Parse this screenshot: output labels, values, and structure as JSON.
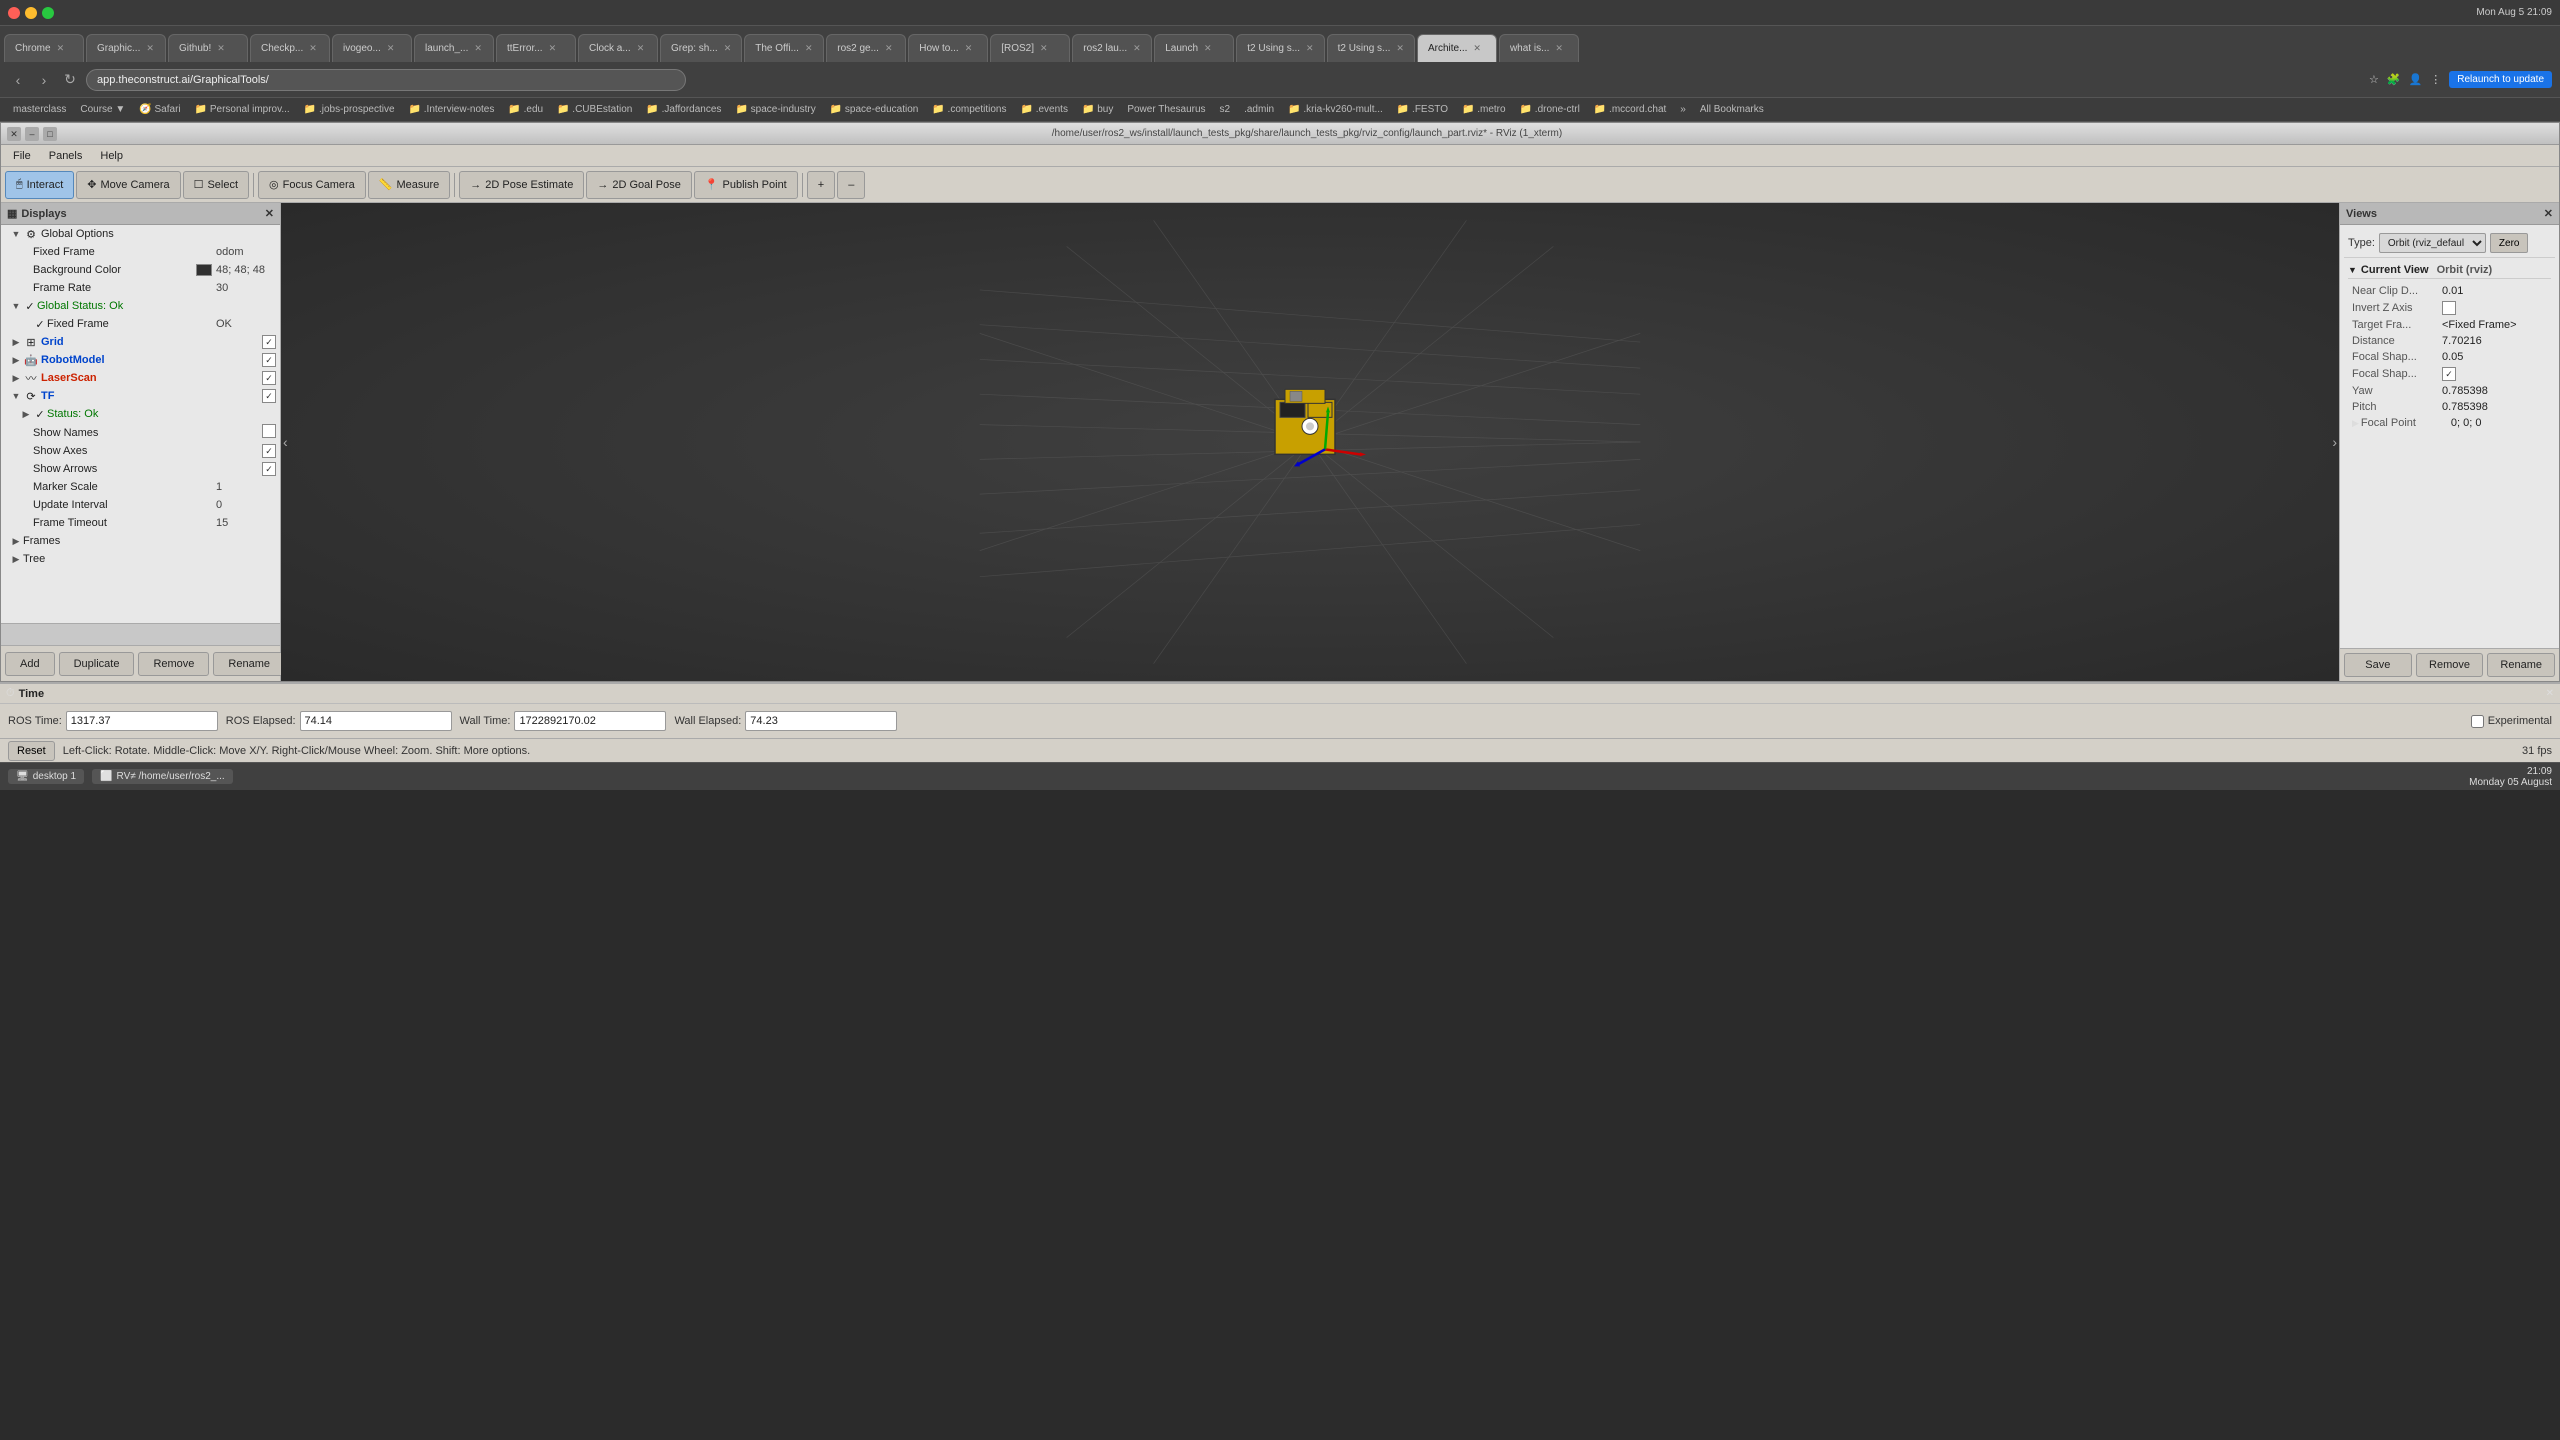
{
  "mac_bar": {
    "dots": [
      "red",
      "yellow",
      "green"
    ]
  },
  "tabs": [
    {
      "label": "Chrome",
      "active": false
    },
    {
      "label": "Graphic...",
      "active": false
    },
    {
      "label": "Github!",
      "active": false
    },
    {
      "label": "Checkp...",
      "active": false
    },
    {
      "label": "ivogeo...",
      "active": false
    },
    {
      "label": "launch_...",
      "active": false
    },
    {
      "label": "ttError...",
      "active": false
    },
    {
      "label": "Clock a...",
      "active": false
    },
    {
      "label": "Grep: sh...",
      "active": false
    },
    {
      "label": "The Offi...",
      "active": false
    },
    {
      "label": "ros2 ge...",
      "active": false
    },
    {
      "label": "How to...",
      "active": false
    },
    {
      "label": "[ROS2]",
      "active": false
    },
    {
      "label": "ros2 lau...",
      "active": false
    },
    {
      "label": "Launch",
      "active": false
    },
    {
      "label": "t2 Using s...",
      "active": false
    },
    {
      "label": "t2 Using s...",
      "active": false
    },
    {
      "label": "Archite...",
      "active": true
    },
    {
      "label": "what is...",
      "active": false
    }
  ],
  "address_bar": {
    "url": "app.theconstruct.ai/GraphicalTools/",
    "relaunch_label": "Relaunch to update"
  },
  "bookmarks": [
    "masterclass",
    "Course ▼",
    "Safari",
    "Personal improv...",
    ".jobs-prospective",
    ".Interview-notes",
    ".edu",
    ".CUBEstation",
    ".Jaffordances",
    "space-industry",
    "space-education",
    ".competitions",
    ".events",
    "buy",
    "Power Thesaurus",
    "s2",
    ".admin",
    ".kria-kv260-mult...",
    ".FESTO",
    ".metro",
    ".drone-ctrl",
    ".mccord.chat"
  ],
  "rviz_title": "/home/user/ros2_ws/install/launch_tests_pkg/share/launch_tests_pkg/rviz_config/launch_part.rviz* - RViz (1_xterm)",
  "menu_items": [
    "File",
    "Panels",
    "Help"
  ],
  "toolbar": {
    "interact": "Interact",
    "move_camera": "Move Camera",
    "select": "Select",
    "focus_camera": "Focus Camera",
    "measure": "Measure",
    "pose_estimate": "2D Pose Estimate",
    "goal_pose": "2D Goal Pose",
    "publish_point": "Publish Point"
  },
  "displays": {
    "panel_title": "Displays",
    "items": [
      {
        "level": 0,
        "has_arrow": true,
        "expanded": true,
        "check": false,
        "icon": "gear",
        "label": "Global Options",
        "value": ""
      },
      {
        "level": 1,
        "has_arrow": false,
        "expanded": false,
        "check": false,
        "icon": "",
        "label": "Fixed Frame",
        "value": "odom"
      },
      {
        "level": 1,
        "has_arrow": false,
        "expanded": false,
        "check": false,
        "icon": "",
        "label": "Background Color",
        "value": "48; 48; 48",
        "color_box": "#303030"
      },
      {
        "level": 1,
        "has_arrow": false,
        "expanded": false,
        "check": false,
        "icon": "",
        "label": "Frame Rate",
        "value": "30"
      },
      {
        "level": 0,
        "has_arrow": true,
        "expanded": true,
        "check": true,
        "icon": "check",
        "label": "Global Status: Ok",
        "value": ""
      },
      {
        "level": 1,
        "has_arrow": false,
        "expanded": false,
        "check": true,
        "icon": "check",
        "label": "Fixed Frame",
        "value": "OK"
      },
      {
        "level": 0,
        "has_arrow": true,
        "expanded": false,
        "check": true,
        "icon": "grid",
        "label": "Grid",
        "value": "",
        "label_class": "blue"
      },
      {
        "level": 0,
        "has_arrow": true,
        "expanded": false,
        "check": true,
        "icon": "robot",
        "label": "RobotModel",
        "value": "",
        "label_class": "blue"
      },
      {
        "level": 0,
        "has_arrow": true,
        "expanded": false,
        "check": true,
        "icon": "laser",
        "label": "LaserScan",
        "value": "",
        "label_class": "red"
      },
      {
        "level": 0,
        "has_arrow": true,
        "expanded": true,
        "check": true,
        "icon": "tf",
        "label": "TF",
        "value": "",
        "label_class": "blue"
      },
      {
        "level": 1,
        "has_arrow": true,
        "expanded": true,
        "check": true,
        "icon": "check",
        "label": "Status: Ok",
        "value": ""
      },
      {
        "level": 1,
        "has_arrow": false,
        "expanded": false,
        "check": false,
        "icon": "",
        "label": "Show Names",
        "value": "",
        "checkbox": false
      },
      {
        "level": 1,
        "has_arrow": false,
        "expanded": false,
        "check": false,
        "icon": "",
        "label": "Show Axes",
        "value": "",
        "checkbox": true
      },
      {
        "level": 1,
        "has_arrow": false,
        "expanded": false,
        "check": false,
        "icon": "",
        "label": "Show Arrows",
        "value": "",
        "checkbox": true
      },
      {
        "level": 1,
        "has_arrow": false,
        "expanded": false,
        "check": false,
        "icon": "",
        "label": "Marker Scale",
        "value": "1"
      },
      {
        "level": 1,
        "has_arrow": false,
        "expanded": false,
        "check": false,
        "icon": "",
        "label": "Update Interval",
        "value": "0"
      },
      {
        "level": 1,
        "has_arrow": false,
        "expanded": false,
        "check": false,
        "icon": "",
        "label": "Frame Timeout",
        "value": "15"
      },
      {
        "level": 0,
        "has_arrow": true,
        "expanded": false,
        "check": false,
        "icon": "",
        "label": "Frames",
        "value": ""
      },
      {
        "level": 0,
        "has_arrow": true,
        "expanded": false,
        "check": false,
        "icon": "",
        "label": "Tree",
        "value": ""
      }
    ],
    "buttons": [
      "Add",
      "Duplicate",
      "Remove",
      "Rename"
    ]
  },
  "views": {
    "panel_title": "Views",
    "type_label": "Type:",
    "type_value": "Orbit (rviz_defaul",
    "zero_label": "Zero",
    "current_view": {
      "label": "Current View",
      "orbit_label": "Orbit (rviz)",
      "properties": [
        {
          "label": "Near Clip D...",
          "value": "0.01"
        },
        {
          "label": "Invert Z Axis",
          "value": "",
          "checkbox": false
        },
        {
          "label": "Target Fra...",
          "value": "<Fixed Frame>"
        },
        {
          "label": "Distance",
          "value": "7.70216"
        },
        {
          "label": "Focal Shap...",
          "value": "0.05"
        },
        {
          "label": "Focal Shap...",
          "value": "",
          "checkbox": true
        },
        {
          "label": "Yaw",
          "value": "0.785398"
        },
        {
          "label": "Pitch",
          "value": "0.785398"
        },
        {
          "label": "Focal Point",
          "value": "0; 0; 0",
          "has_arrow": true
        }
      ]
    },
    "buttons": [
      "Save",
      "Remove",
      "Rename"
    ]
  },
  "time_bar": {
    "title": "Time",
    "ros_time_label": "ROS Time:",
    "ros_time_value": "1317.37",
    "ros_elapsed_label": "ROS Elapsed:",
    "ros_elapsed_value": "74.14",
    "wall_time_label": "Wall Time:",
    "wall_time_value": "1722892170.02",
    "wall_elapsed_label": "Wall Elapsed:",
    "wall_elapsed_value": "74.23",
    "experimental_label": "Experimental"
  },
  "status_bar": {
    "hint": "Left-Click: Rotate.  Middle-Click: Move X/Y.  Right-Click/Mouse Wheel: Zoom.  Shift: More options.",
    "fps": "31 fps",
    "reset_label": "Reset"
  },
  "taskbar": {
    "desktop_label": "desktop 1",
    "rviz_label": "RV≠ /home/user/ros2_...",
    "time": "21:09",
    "date": "Monday 05 August"
  }
}
